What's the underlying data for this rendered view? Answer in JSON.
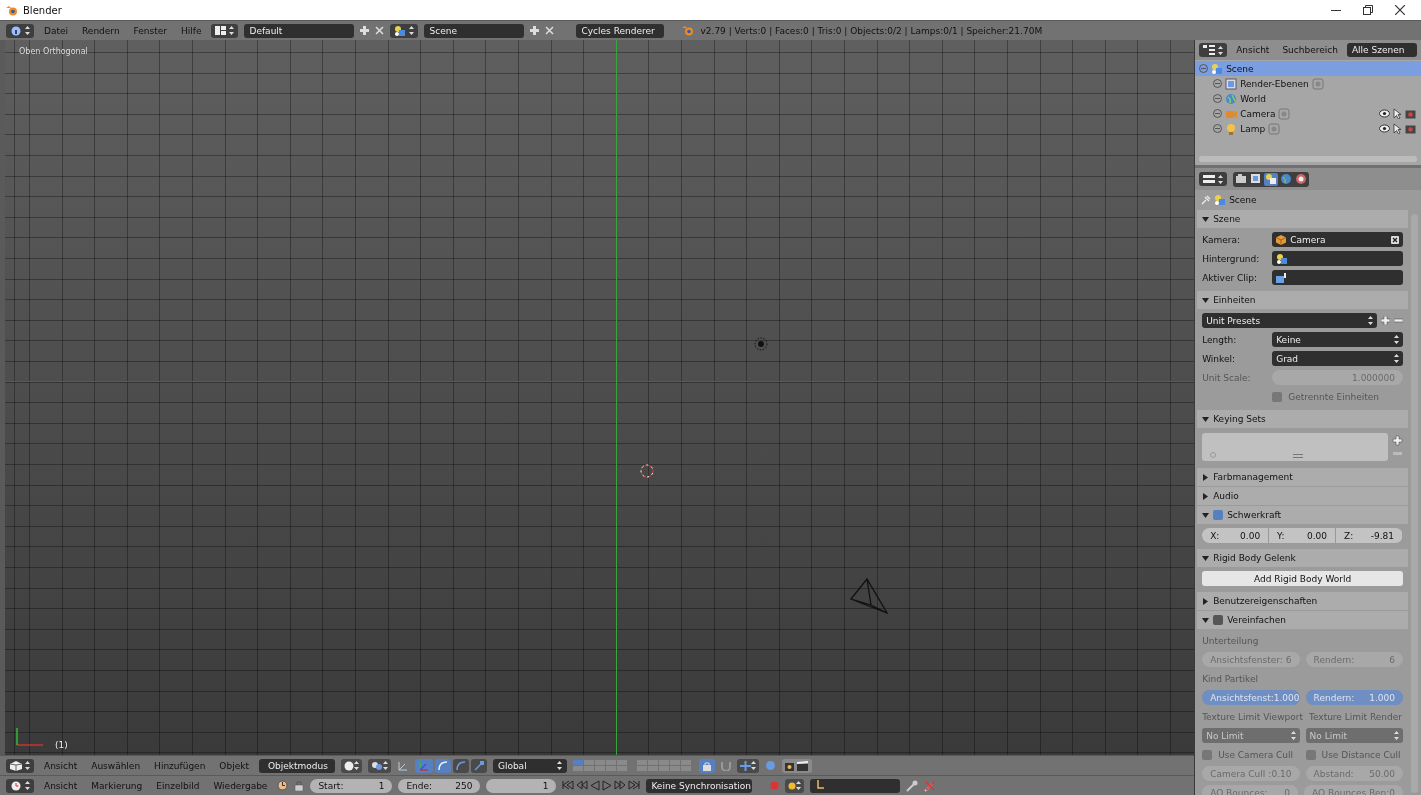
{
  "window": {
    "title": "Blender"
  },
  "info_header": {
    "menus": [
      "Datei",
      "Rendern",
      "Fenster",
      "Hilfe"
    ],
    "layout": "Default",
    "scene": "Scene",
    "renderer": "Cycles Renderer",
    "stats": "v2.79 | Verts:0 | Faces:0 | Tris:0 | Objects:0/2 | Lamps:0/1 | Speicher:21.70M"
  },
  "viewport": {
    "view_label": "Oben Orthogonal",
    "frame_label": "(1)"
  },
  "viewport_header": {
    "menus": [
      "Ansicht",
      "Auswählen",
      "Hinzufügen",
      "Objekt"
    ],
    "mode": "Objektmodus",
    "orientation": "Global"
  },
  "timeline_header": {
    "menus": [
      "Ansicht",
      "Markierung",
      "Einzelbild",
      "Wiedergabe"
    ],
    "start_label": "Start:",
    "start": "1",
    "end_label": "Ende:",
    "end": "250",
    "current_frame": "1",
    "sync": "Keine Synchronisation"
  },
  "outliner": {
    "menus": [
      "Ansicht",
      "Suchbereich"
    ],
    "display_mode": "Alle Szenen",
    "tree": [
      {
        "kind": "scene",
        "label": "Scene",
        "selected": true,
        "children": [
          {
            "kind": "layers",
            "label": "Render-Ebenen",
            "selected": false
          },
          {
            "kind": "world",
            "label": "World",
            "selected": false
          },
          {
            "kind": "camera",
            "label": "Camera",
            "selected": false
          },
          {
            "kind": "lamp",
            "label": "Lamp",
            "selected": false
          }
        ]
      }
    ]
  },
  "properties": {
    "context_tabs": [
      {
        "kind": "render",
        "selected": false
      },
      {
        "kind": "layers",
        "selected": false
      },
      {
        "kind": "scene",
        "selected": true
      },
      {
        "kind": "world",
        "selected": false
      },
      {
        "kind": "object",
        "selected": false
      }
    ],
    "context": "Scene",
    "panels": [
      {
        "title": "Szene",
        "expanded": true,
        "rows": [
          {
            "kind": "objectfield",
            "label": "Kamera:",
            "value": "Camera"
          },
          {
            "kind": "scenefield",
            "label": "Hintergrund:"
          },
          {
            "kind": "clipfield",
            "label": "Aktiver Clip:"
          }
        ]
      },
      {
        "title": "Einheiten",
        "expanded": true,
        "rows": [
          {
            "kind": "preset",
            "value": "Unit Presets"
          },
          {
            "kind": "dropdown",
            "label": "Length:",
            "value": "Keine"
          },
          {
            "kind": "dropdown",
            "label": "Winkel:",
            "value": "Grad"
          },
          {
            "kind": "number",
            "label": "Unit Scale:",
            "value": "1.000000",
            "disabled": true
          },
          {
            "kind": "checkbox",
            "label": "Getrennte Einheiten",
            "checked": false,
            "disabled": true
          }
        ]
      },
      {
        "title": "Keying Sets",
        "expanded": true,
        "rows": [
          {
            "kind": "list"
          }
        ]
      },
      {
        "title": "Farbmanagement",
        "expanded": false
      },
      {
        "title": "Audio",
        "expanded": false
      },
      {
        "title": "Schwerkraft",
        "expanded": true,
        "checked": true,
        "rows": [
          {
            "kind": "vector",
            "values": [
              {
                "label": "X:",
                "value": "0.00"
              },
              {
                "label": "Y:",
                "value": "0.00"
              },
              {
                "label": "Z:",
                "value": "-9.81"
              }
            ]
          }
        ]
      },
      {
        "title": "Rigid Body Gelenk",
        "expanded": true,
        "rows": [
          {
            "kind": "button",
            "label": "Add Rigid Body World"
          }
        ]
      },
      {
        "title": "Benutzereigenschaften",
        "expanded": false
      },
      {
        "title": "Vereinfachen",
        "expanded": true,
        "checked": false,
        "rows": [
          {
            "kind": "caption",
            "label": "Unterteilung",
            "disabled": true
          },
          {
            "kind": "pair",
            "items": [
              {
                "kind": "number",
                "label": "Ansichtsfenster:",
                "value": "6",
                "disabled": true
              },
              {
                "kind": "number",
                "label": "Rendern:",
                "value": "6",
                "disabled": true
              }
            ]
          },
          {
            "kind": "caption",
            "label": "Kind Partikel",
            "disabled": true
          },
          {
            "kind": "pair",
            "items": [
              {
                "kind": "slider",
                "label": "Ansichtsfenst:",
                "value": "1.000",
                "level": 1,
                "disabled": true
              },
              {
                "kind": "slider",
                "label": "Rendern:",
                "value": "1.000",
                "level": 1,
                "disabled": true
              }
            ]
          },
          {
            "kind": "pair",
            "items": [
              {
                "kind": "caption",
                "label": "Texture Limit Viewport",
                "disabled": true
              },
              {
                "kind": "caption",
                "label": "Texture Limit Render",
                "disabled": true
              }
            ]
          },
          {
            "kind": "pair",
            "items": [
              {
                "kind": "dropdown",
                "value": "No Limit",
                "disabled": true
              },
              {
                "kind": "dropdown",
                "value": "No Limit",
                "disabled": true
              }
            ]
          },
          {
            "kind": "pair",
            "items": [
              {
                "kind": "checkbox",
                "label": "Use Camera Cull",
                "checked": false,
                "disabled": true
              },
              {
                "kind": "checkbox",
                "label": "Use Distance Cull",
                "checked": false,
                "disabled": true
              }
            ]
          },
          {
            "kind": "pair",
            "items": [
              {
                "kind": "number",
                "label": "Camera Cull :",
                "value": "0.10",
                "disabled": true
              },
              {
                "kind": "number",
                "label": "Abstand:",
                "value": "50.00",
                "disabled": true
              }
            ]
          },
          {
            "kind": "pair",
            "items": [
              {
                "kind": "number",
                "label": "AO Bounces:",
                "value": "0",
                "disabled": true
              },
              {
                "kind": "number",
                "label": "AO Bounces Ren:",
                "value": "0",
                "disabled": true
              }
            ]
          }
        ]
      }
    ]
  }
}
